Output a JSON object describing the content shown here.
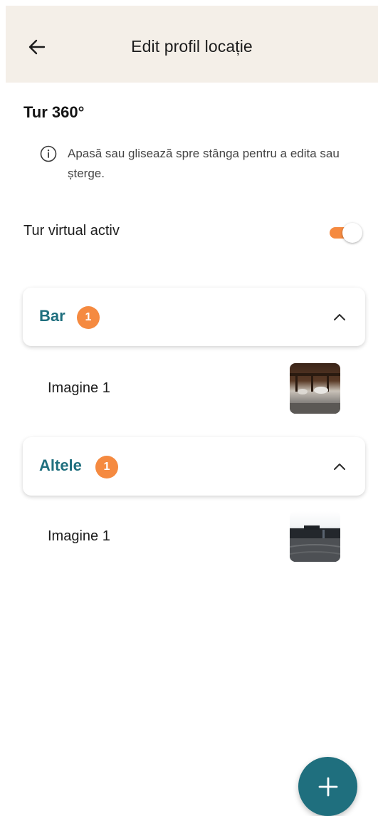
{
  "header": {
    "title": "Edit profil locație",
    "back_icon": "arrow-left-icon"
  },
  "section": {
    "title": "Tur 360°",
    "hint_icon": "info-icon",
    "hint_text": "Apasă sau glisează spre stânga pentru a edita sau șterge."
  },
  "toggle": {
    "label": "Tur virtual activ",
    "on": true
  },
  "groups": [
    {
      "title": "Bar",
      "count": "1",
      "expanded": true,
      "items": [
        {
          "label": "Imagine 1",
          "thumbnail": "panorama-bar-image"
        }
      ]
    },
    {
      "title": "Altele",
      "count": "1",
      "expanded": true,
      "items": [
        {
          "label": "Imagine 1",
          "thumbnail": "panorama-outdoor-image"
        }
      ]
    }
  ],
  "fab": {
    "icon": "plus-icon"
  },
  "colors": {
    "header_bg": "#f4efe8",
    "accent_orange": "#f58a40",
    "teal": "#1f6f7e",
    "text": "#1c1c1c"
  }
}
